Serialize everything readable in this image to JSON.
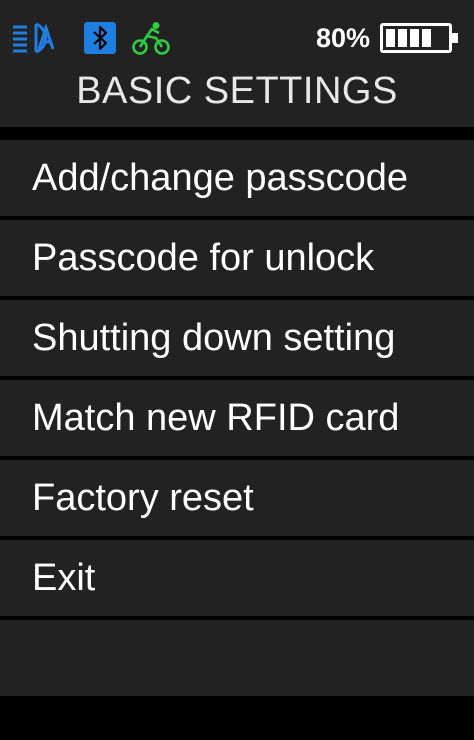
{
  "status_bar": {
    "icons": [
      "auto-headlight-icon",
      "bluetooth-icon",
      "bike-assist-icon"
    ],
    "battery_percent_label": "80%",
    "battery_level": 0.8,
    "colors": {
      "auto_light": "#1f7fe0",
      "bluetooth_bg": "#1f7fe0",
      "bike": "#2ecc40"
    }
  },
  "header": {
    "title": "BASIC SETTINGS"
  },
  "menu": {
    "items": [
      {
        "label": "Add/change passcode"
      },
      {
        "label": "Passcode for unlock"
      },
      {
        "label": "Shutting down setting"
      },
      {
        "label": "Match new RFID card"
      },
      {
        "label": "Factory reset"
      },
      {
        "label": "Exit"
      }
    ]
  },
  "colors": {
    "background": "#000000",
    "panel": "#222222",
    "text": "#ffffff"
  }
}
